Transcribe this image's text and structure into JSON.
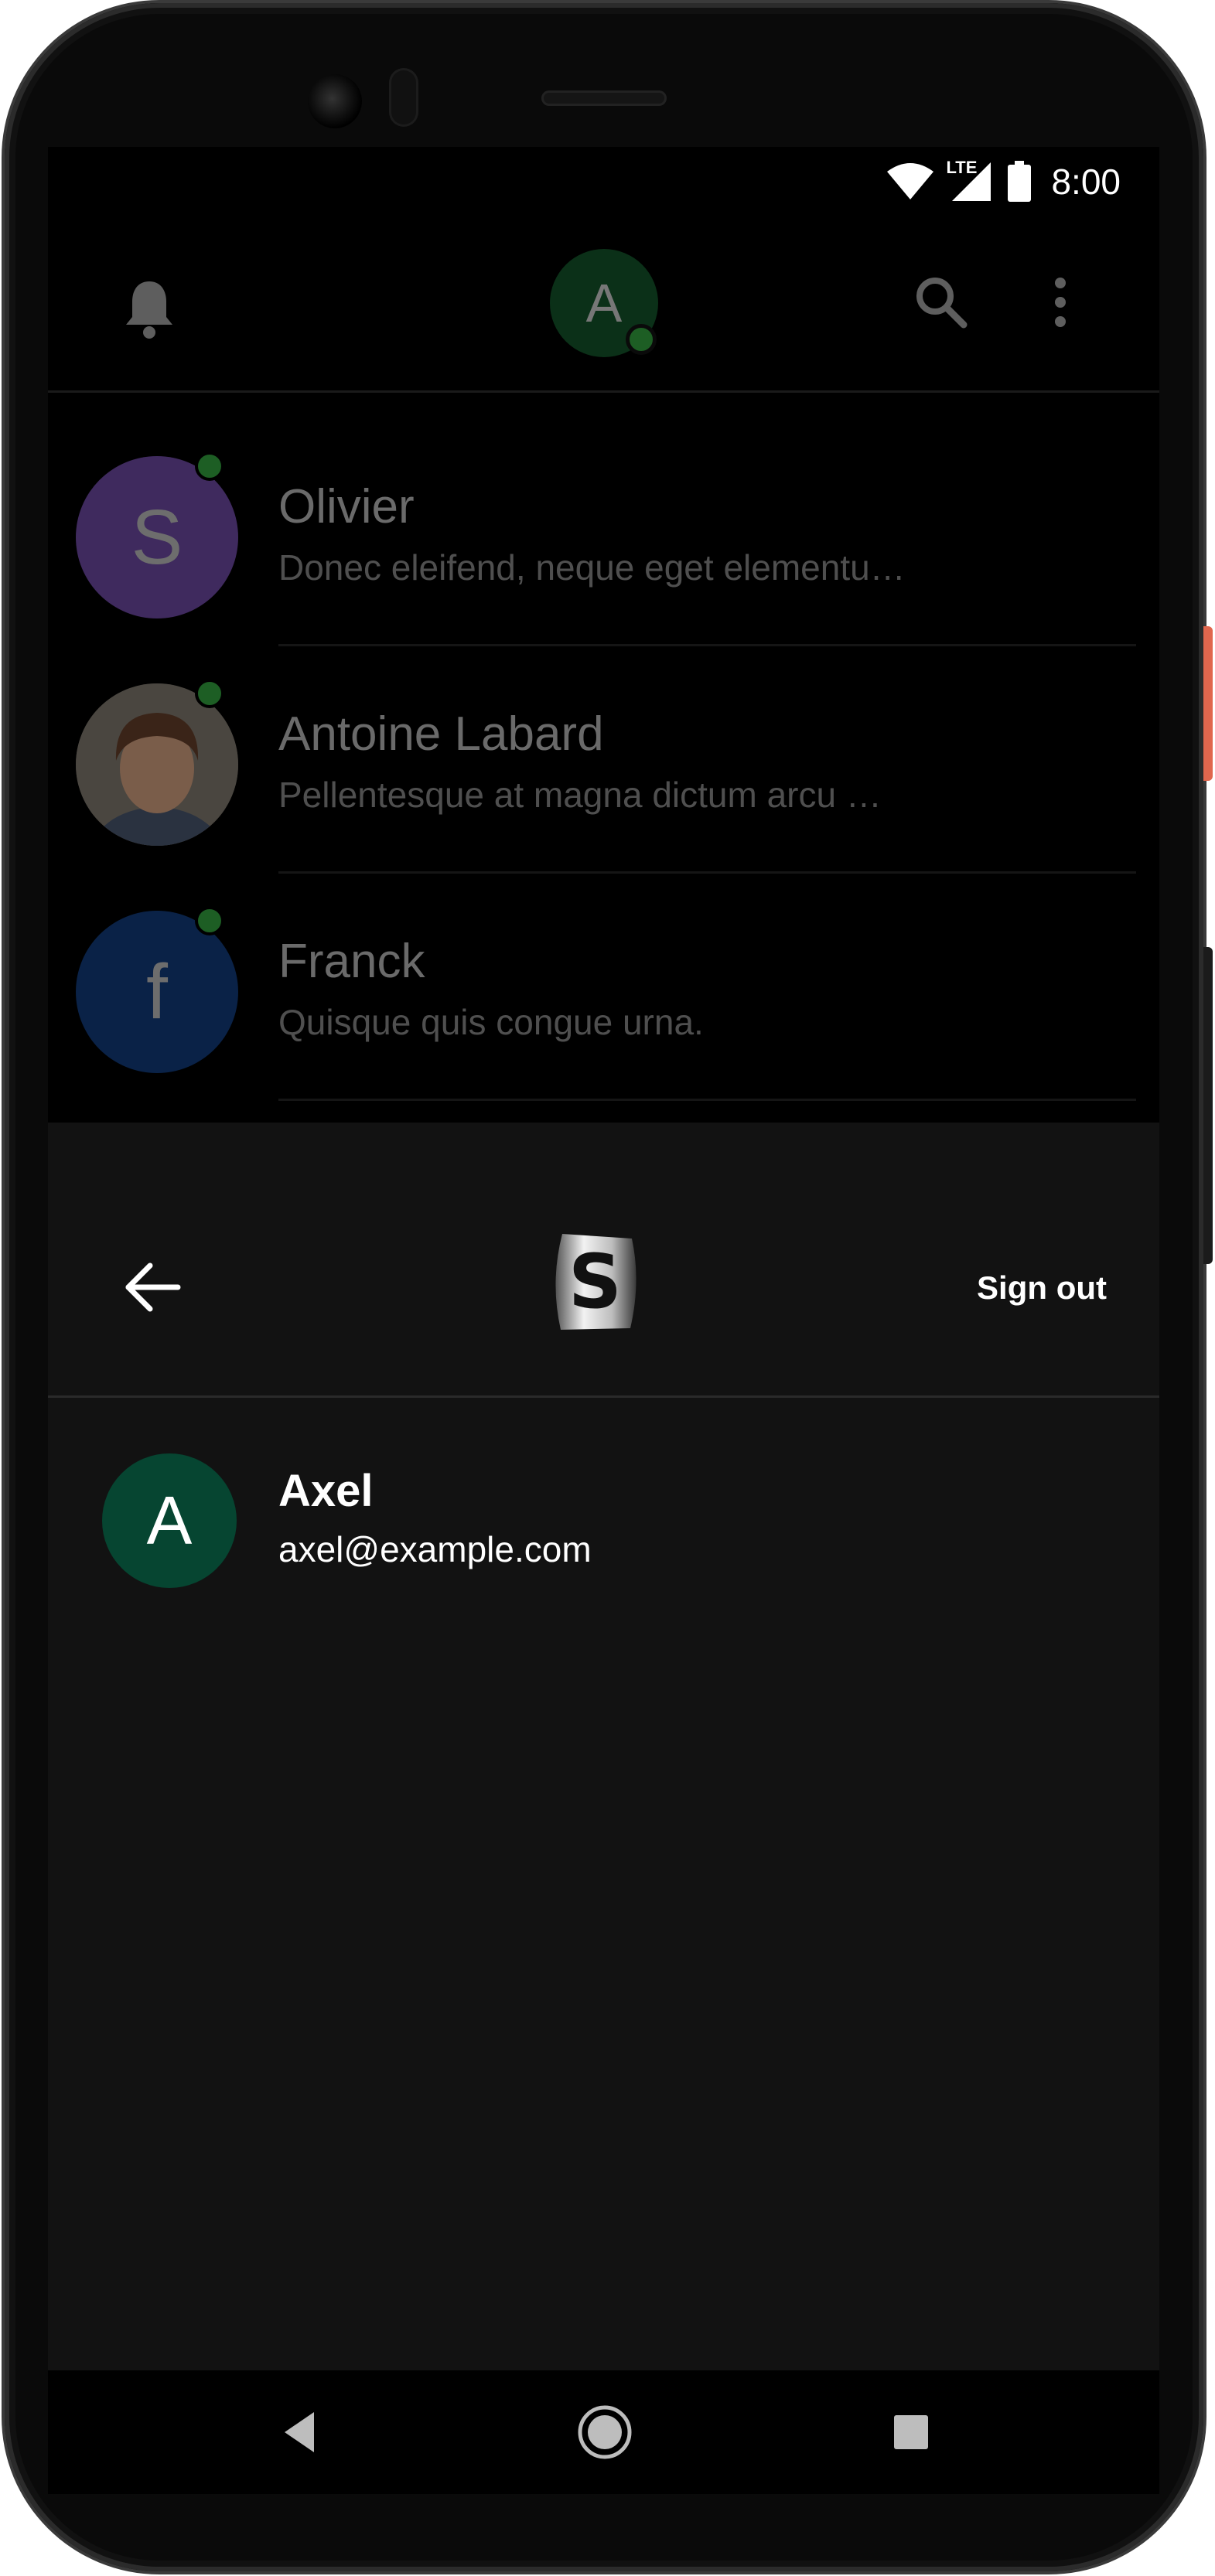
{
  "status_bar": {
    "network": "LTE",
    "time": "8:00"
  },
  "top_bar": {
    "avatar_letter": "A"
  },
  "conversations": [
    {
      "avatar_letter": "S",
      "avatar_color": "#3f2a5e",
      "name": "Olivier",
      "preview": "Donec eleifend, neque eget elementu…",
      "online": true
    },
    {
      "avatar_letter": "",
      "avatar_color": "#3a3530",
      "name": "Antoine Labard",
      "preview": "Pellentesque at magna dictum arcu …",
      "online": true
    },
    {
      "avatar_letter": "f",
      "avatar_color": "#0a2247",
      "name": "Franck",
      "preview": "Quisque quis congue urna.",
      "online": true
    }
  ],
  "sheet": {
    "logo_letter": "S",
    "sign_out_label": "Sign out",
    "account": {
      "avatar_letter": "A",
      "name": "Axel",
      "email": "axel@example.com"
    }
  },
  "colors": {
    "presence": "#1d5e24",
    "account_avatar": "#064531",
    "sheet_bg": "#121212"
  }
}
